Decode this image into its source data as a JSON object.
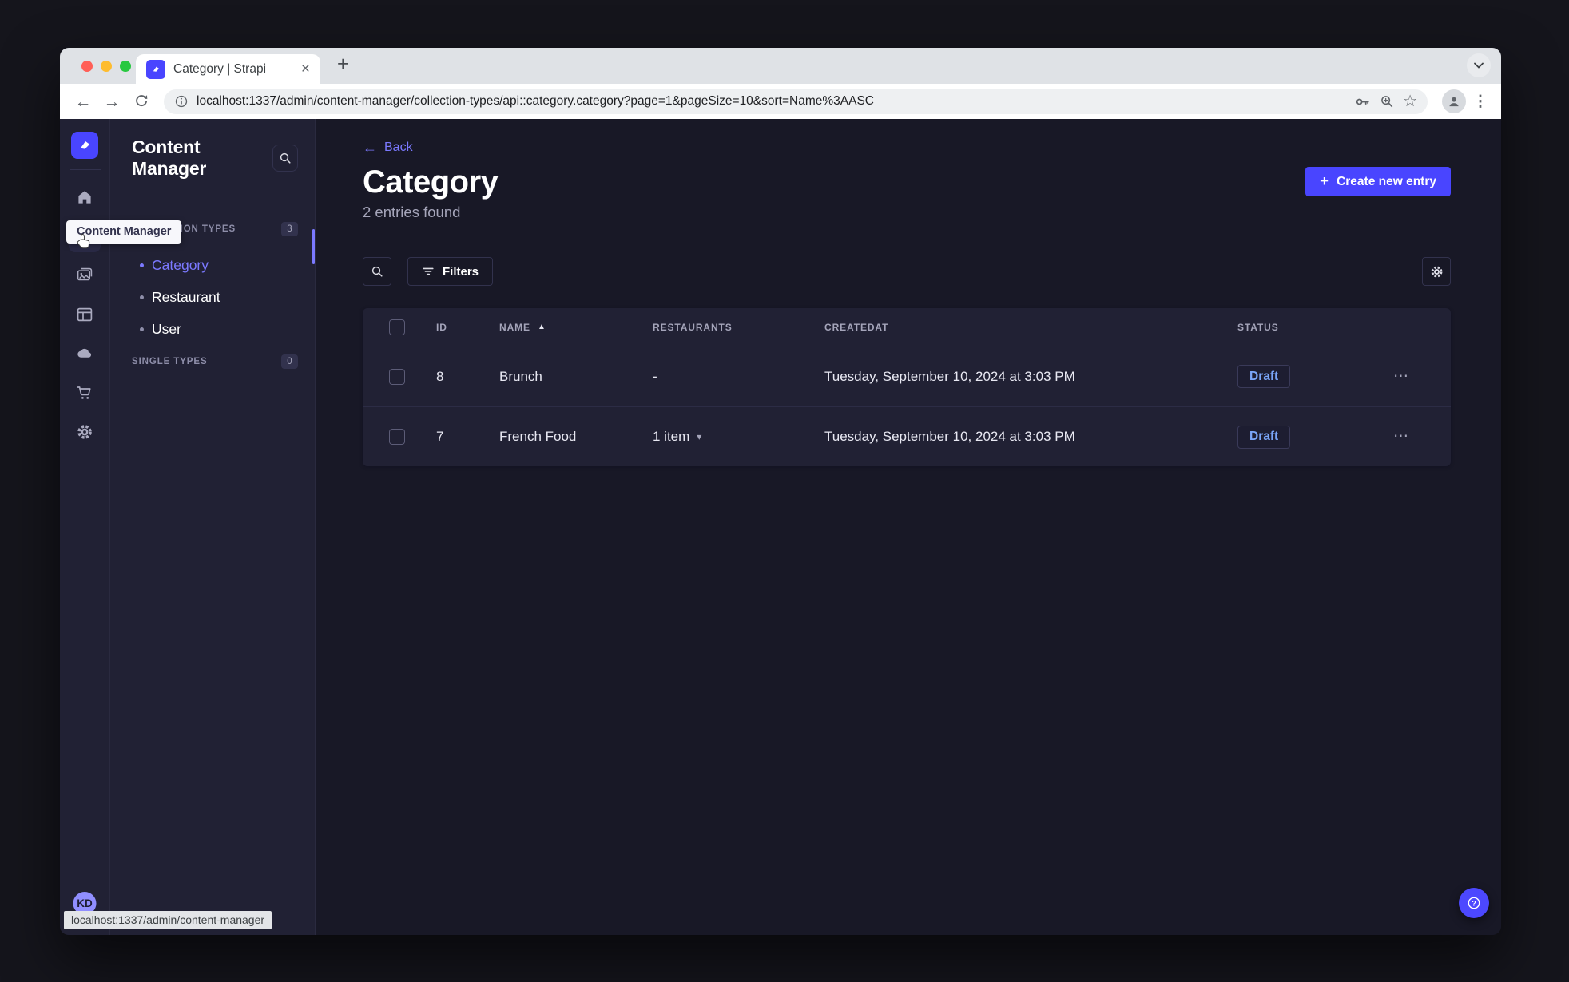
{
  "browser": {
    "tab_title": "Category | Strapi",
    "url": "localhost:1337/admin/content-manager/collection-types/api::category.category?page=1&pageSize=10&sort=Name%3AASC",
    "status_link": "localhost:1337/admin/content-manager"
  },
  "icons": {
    "close": "×",
    "new_tab": "+",
    "back_arrow": "←",
    "forward_arrow": "→",
    "star": "☆",
    "kebab": "⋮",
    "more": "⋯",
    "sort_asc": "▲",
    "chevron_down": "▾",
    "plus": "+"
  },
  "rail": {
    "tooltip": "Content Manager",
    "avatar_initials": "KD"
  },
  "subnav": {
    "title": "Content Manager",
    "collection_types": {
      "label": "COLLECTION TYPES",
      "count": "3",
      "items": [
        "Category",
        "Restaurant",
        "User"
      ],
      "active_item": "Category"
    },
    "single_types": {
      "label": "SINGLE TYPES",
      "count": "0"
    }
  },
  "page": {
    "back": "Back",
    "title": "Category",
    "subtitle": "2 entries found",
    "create_button": "Create new entry",
    "filters_button": "Filters"
  },
  "table": {
    "columns": [
      "ID",
      "NAME",
      "RESTAURANTS",
      "CREATEDAT",
      "STATUS"
    ],
    "sorted_column": "NAME",
    "sort_direction": "ASC",
    "rows": [
      {
        "id": "8",
        "name": "Brunch",
        "restaurants": "-",
        "created_at": "Tuesday, September 10, 2024 at 3:03 PM",
        "status": "Draft"
      },
      {
        "id": "7",
        "name": "French Food",
        "restaurants": "1 item",
        "created_at": "Tuesday, September 10, 2024 at 3:03 PM",
        "status": "Draft"
      }
    ]
  },
  "colors": {
    "accent": "#4945ff",
    "accent_light": "#7b79ff",
    "draft_text": "#7aa5f8",
    "panel": "#212134",
    "page_bg": "#181826"
  }
}
